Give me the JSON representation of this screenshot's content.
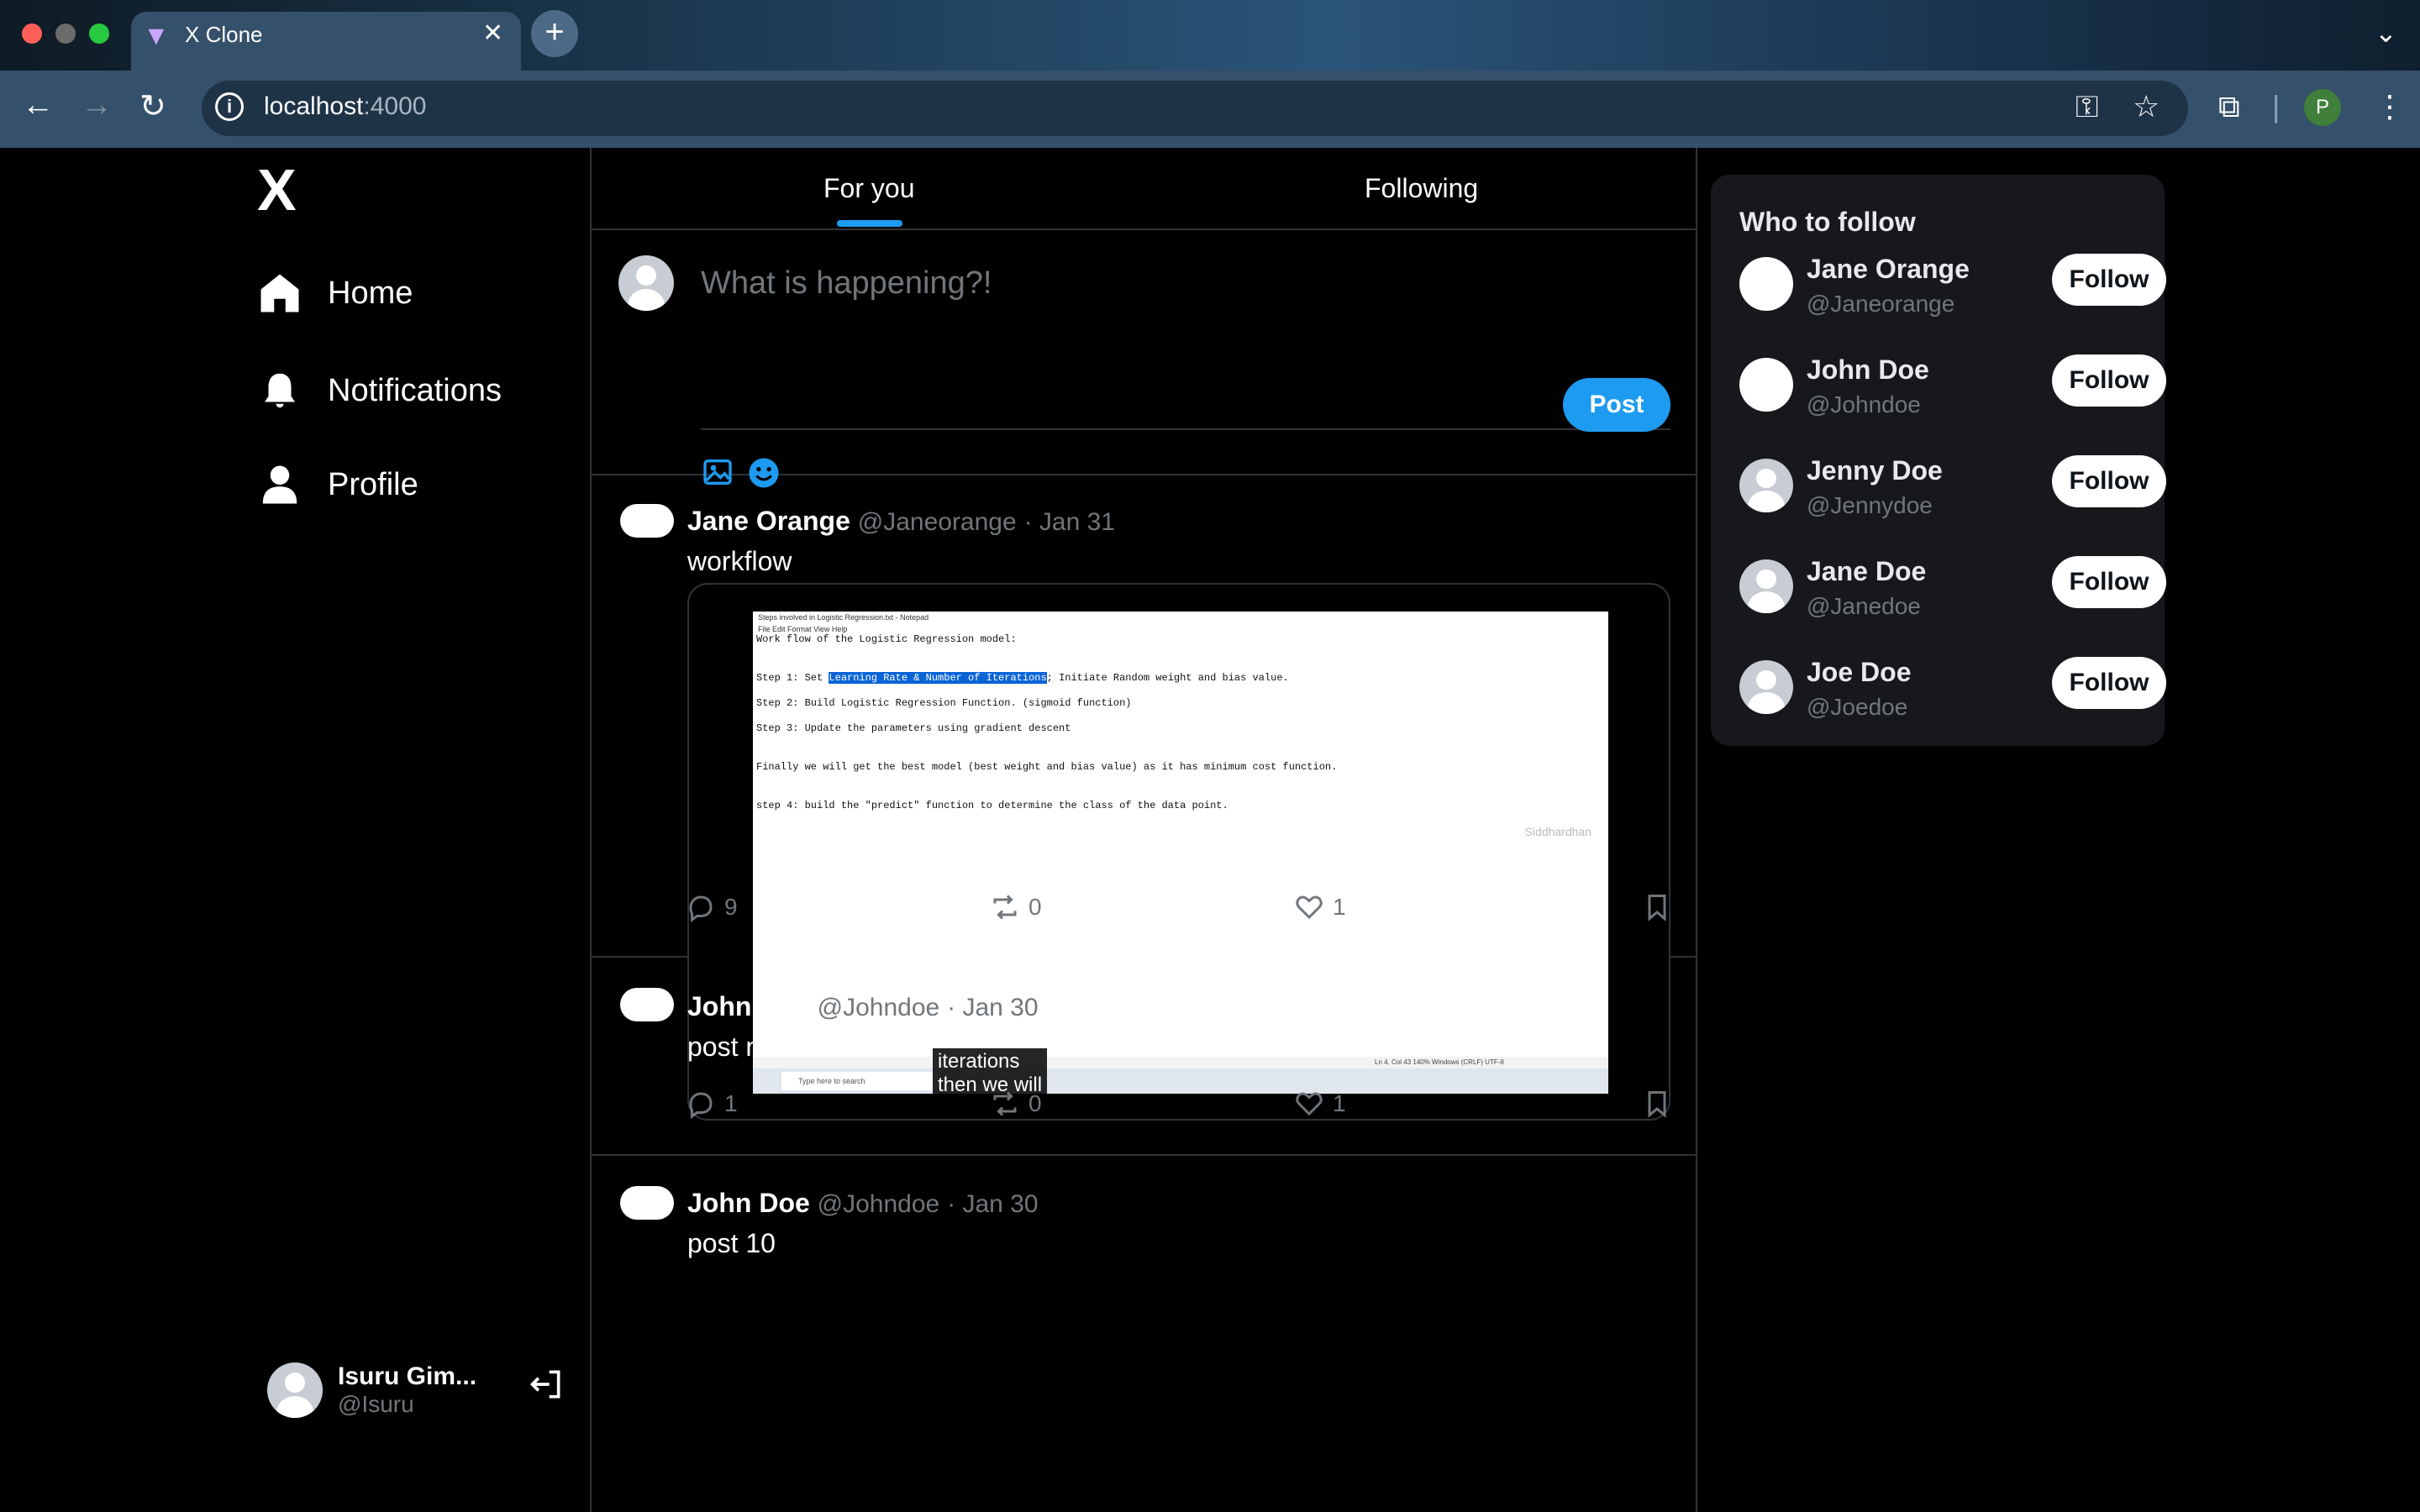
{
  "browser": {
    "tab_title": "X Clone",
    "url_host": "localhost",
    "url_port": ":4000",
    "profile_initial": "P"
  },
  "sidebar": {
    "logo": "X",
    "items": [
      {
        "label": "Home",
        "icon": "home-icon"
      },
      {
        "label": "Notifications",
        "icon": "bell-icon"
      },
      {
        "label": "Profile",
        "icon": "user-icon"
      }
    ],
    "current_user": {
      "name": "Isuru Gim...",
      "handle": "@Isuru"
    }
  },
  "feed": {
    "tabs": [
      "For you",
      "Following"
    ],
    "active_tab": "For you",
    "composer": {
      "placeholder": "What is happening?!",
      "post_label": "Post"
    },
    "posts": [
      {
        "name": "Jane Orange",
        "handle": "@Janeorange",
        "date": "· Jan 31",
        "text": "workflow",
        "replies": "9",
        "reposts": "0",
        "likes": "1",
        "media": {
          "window_title": "Steps involved in Logistic Regression.txt - Notepad",
          "menu": "File   Edit   Format   View   Help",
          "lines": [
            "Work flow of the Logistic Regression model:",
            "Step 1: Set ",
            "Learning Rate & Number of Iterations",
            "; Initiate Random weight and bias value.",
            "Step 2: Build Logistic Regression Function. (sigmoid function)",
            "Step 3: Update the parameters using gradient descent",
            "Finally we will get the best model (best weight and bias value) as it has minimum cost function.",
            "step 4: build the \"predict\" function to determine the class of the data point."
          ],
          "watermark": "Siddhardhan",
          "status": "Ln 4, Col 43        140%        Windows (CRLF)        UTF-8",
          "search_placeholder": "Type here to search",
          "caption_line1": "iterations",
          "caption_line2": "then we will"
        }
      },
      {
        "name": "John Doe",
        "handle": "@Johndoe",
        "date": "· Jan 30",
        "text": "post new",
        "replies": "1",
        "reposts": "0",
        "likes": "1"
      },
      {
        "name": "John Doe",
        "handle": "@Johndoe",
        "date": "· Jan 30",
        "text": "post 10"
      }
    ]
  },
  "who_to_follow": {
    "title": "Who to follow",
    "follow_label": "Follow",
    "users": [
      {
        "name": "Jane Orange",
        "handle": "@Janeorange"
      },
      {
        "name": "John Doe",
        "handle": "@Johndoe"
      },
      {
        "name": "Jenny Doe",
        "handle": "@Jennydoe"
      },
      {
        "name": "Jane Doe",
        "handle": "@Janedoe"
      },
      {
        "name": "Joe Doe",
        "handle": "@Joedoe"
      }
    ]
  },
  "colors": {
    "accent": "#1d9bf0",
    "background": "#000000",
    "border": "#2f3336",
    "muted": "#71767b"
  }
}
